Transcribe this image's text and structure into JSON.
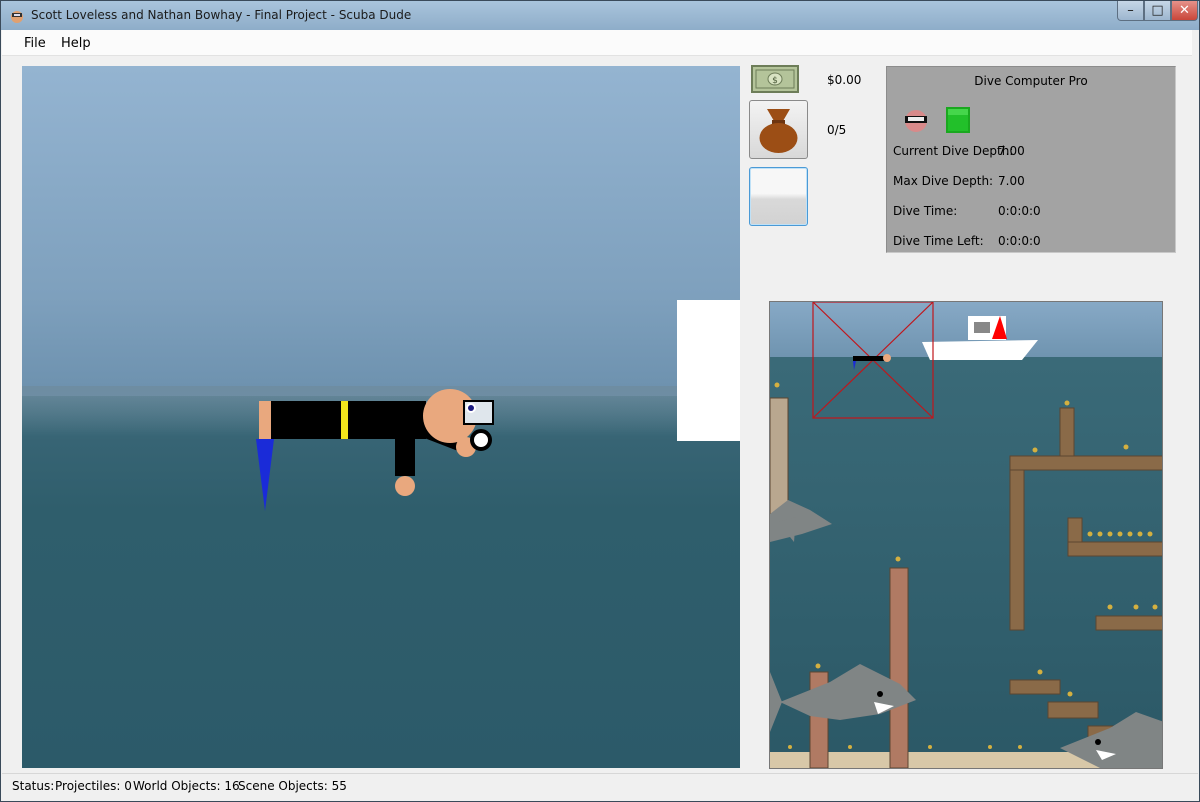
{
  "window": {
    "title": "Scott Loveless and Nathan Bowhay - Final Project - Scuba Dude",
    "minimize_glyph": "–",
    "maximize_glyph": "□",
    "close_glyph": "✕"
  },
  "menu": {
    "file": "File",
    "help": "Help"
  },
  "inventory": {
    "cash_icon": "dollar-bill-icon",
    "cash_value": "$0.00",
    "bag_icon": "treasure-bag-icon",
    "bag_count": "0/5"
  },
  "dive_computer": {
    "title": "Dive Computer Pro",
    "mask_icon": "dive-mask-icon",
    "tank_icon": "air-tank-icon",
    "tank_color": "#22c02a",
    "rows": [
      {
        "label": "Current Dive Depth:",
        "value": "7.00"
      },
      {
        "label": "Max Dive Depth:",
        "value": "7.00"
      },
      {
        "label": "Dive Time:",
        "value": "0:0:0:0"
      },
      {
        "label": "Dive Time Left:",
        "value": "0:0:0:0"
      }
    ]
  },
  "status": {
    "label": "Status:",
    "projectiles": "Projectiles: 0",
    "world_objects": "World Objects: 16",
    "scene_objects": "Scene Objects: 55"
  },
  "colors": {
    "sky": "#8eaecb",
    "sea": "#2e5f6e",
    "wetsuit": "#000000",
    "stripe": "#f2e61c",
    "fin": "#1a2bd8",
    "skin": "#e9a87e",
    "viewport_frame": "#c0161c",
    "boat_flag": "#ff0000"
  }
}
